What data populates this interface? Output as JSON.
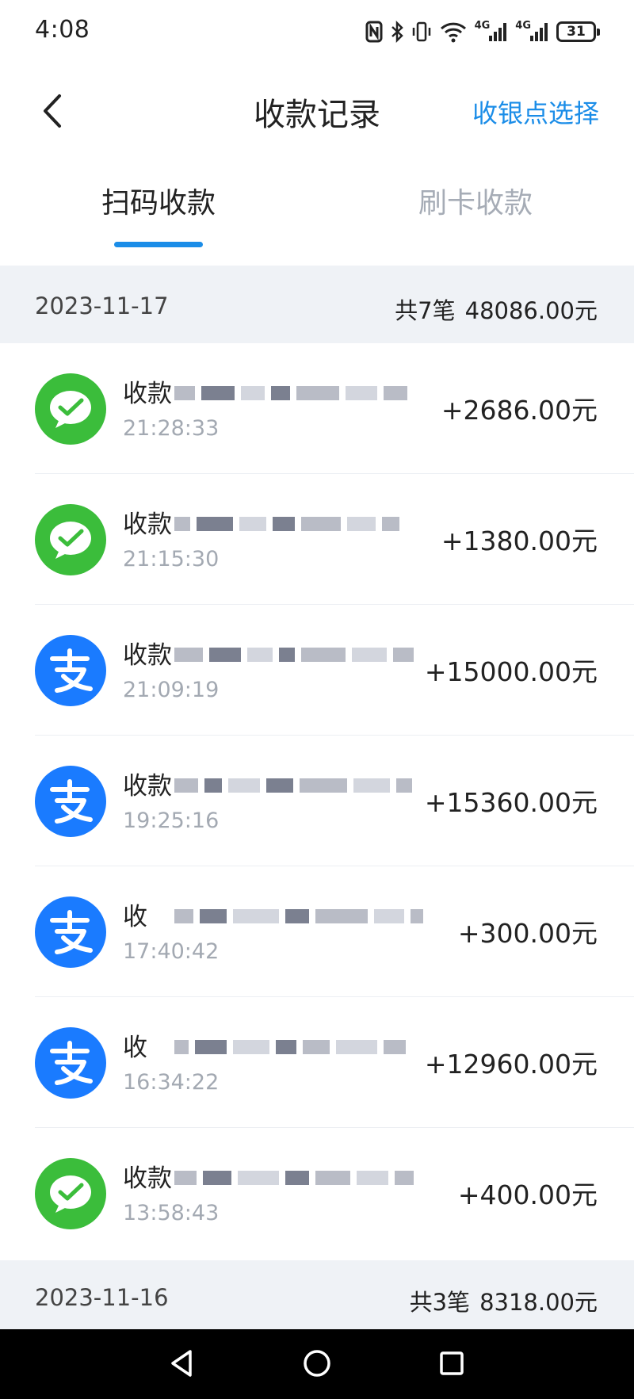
{
  "status_bar": {
    "time": "4:08",
    "network_label_1": "4G",
    "network_label_2": "4G",
    "battery": "31"
  },
  "nav": {
    "title": "收款记录",
    "action_label": "收银点选择"
  },
  "tabs": [
    {
      "label": "扫码收款",
      "active": true
    },
    {
      "label": "刷卡收款",
      "active": false
    }
  ],
  "sections": [
    {
      "date": "2023-11-17",
      "count_text": "共7笔",
      "total_text": "48086.00元",
      "records": [
        {
          "type": "wechat",
          "title": "收款",
          "time": "21:28:33",
          "amount": "+2686.00元"
        },
        {
          "type": "wechat",
          "title": "收款",
          "time": "21:15:30",
          "amount": "+1380.00元"
        },
        {
          "type": "alipay",
          "title": "收款",
          "time": "21:09:19",
          "amount": "+15000.00元"
        },
        {
          "type": "alipay",
          "title": "收款",
          "time": "19:25:16",
          "amount": "+15360.00元"
        },
        {
          "type": "alipay",
          "title": "收",
          "time": "17:40:42",
          "amount": "+300.00元"
        },
        {
          "type": "alipay",
          "title": "收",
          "time": "16:34:22",
          "amount": "+12960.00元"
        },
        {
          "type": "wechat",
          "title": "收款",
          "time": "13:58:43",
          "amount": "+400.00元"
        }
      ]
    },
    {
      "date": "2023-11-16",
      "count_text": "共3笔",
      "total_text": "8318.00元"
    }
  ],
  "icons": {
    "wechat": "wechat-pay-icon",
    "alipay": "alipay-icon",
    "wechat_color": "#3bbd3b",
    "alipay_color": "#1a7bff",
    "accent": "#1b8de8"
  }
}
